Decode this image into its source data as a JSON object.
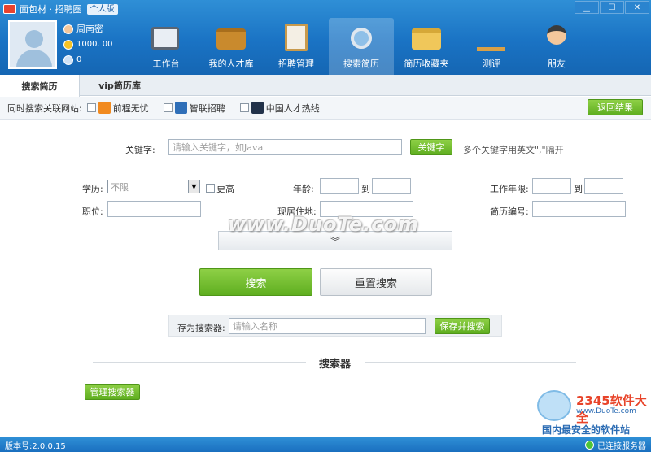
{
  "app": {
    "title": "面包材 · 招聘圈",
    "edition": "个人版"
  },
  "user": {
    "name": "周南密",
    "coins": "1000. 00",
    "messages": "0"
  },
  "nav": {
    "items": [
      {
        "label": "工作台",
        "icon": "monitor-icon"
      },
      {
        "label": "我的人才库",
        "icon": "briefcase-icon"
      },
      {
        "label": "招聘管理",
        "icon": "clipboard-icon"
      },
      {
        "label": "搜索简历",
        "icon": "magnifier-icon",
        "active": true
      },
      {
        "label": "简历收藏夹",
        "icon": "folder-icon"
      },
      {
        "label": "测评",
        "icon": "ruler-icon"
      },
      {
        "label": "朋友",
        "icon": "person-icon"
      }
    ]
  },
  "subtabs": {
    "search_resume": "搜索简历",
    "vip_library": "vip简历库"
  },
  "sites": {
    "label": "同时搜索关联网站:",
    "items": [
      "前程无忧",
      "智联招聘",
      "中国人才热线"
    ]
  },
  "back_button": "返回结果",
  "keyword": {
    "label": "关键字:",
    "placeholder": "请输入关键字，如Java",
    "button": "关键字",
    "hint": "多个关键字用英文\",\"隔开"
  },
  "form": {
    "education_label": "学历:",
    "education_value": "不限",
    "higher_label": "更高",
    "age_label": "年龄:",
    "to_label": "到",
    "work_years_label": "工作年限:",
    "position_label": "职位:",
    "residence_label": "现居住地:",
    "resume_no_label": "简历编号:"
  },
  "buttons": {
    "search": "搜索",
    "reset": "重置搜索"
  },
  "save": {
    "label": "存为搜索器:",
    "placeholder": "请输入名称",
    "button": "保存并搜索"
  },
  "searcher": {
    "title": "搜索器",
    "manage_button": "管理搜索器"
  },
  "status": {
    "version": "版本号:2.0.0.15",
    "connection": "已连接服务器"
  },
  "overlays": {
    "watermark": "www.DuoTe.com",
    "logo_main": "2345软件大全",
    "logo_url": "www.DuoTe.com",
    "logo_slogan": "国内最安全的软件站"
  }
}
